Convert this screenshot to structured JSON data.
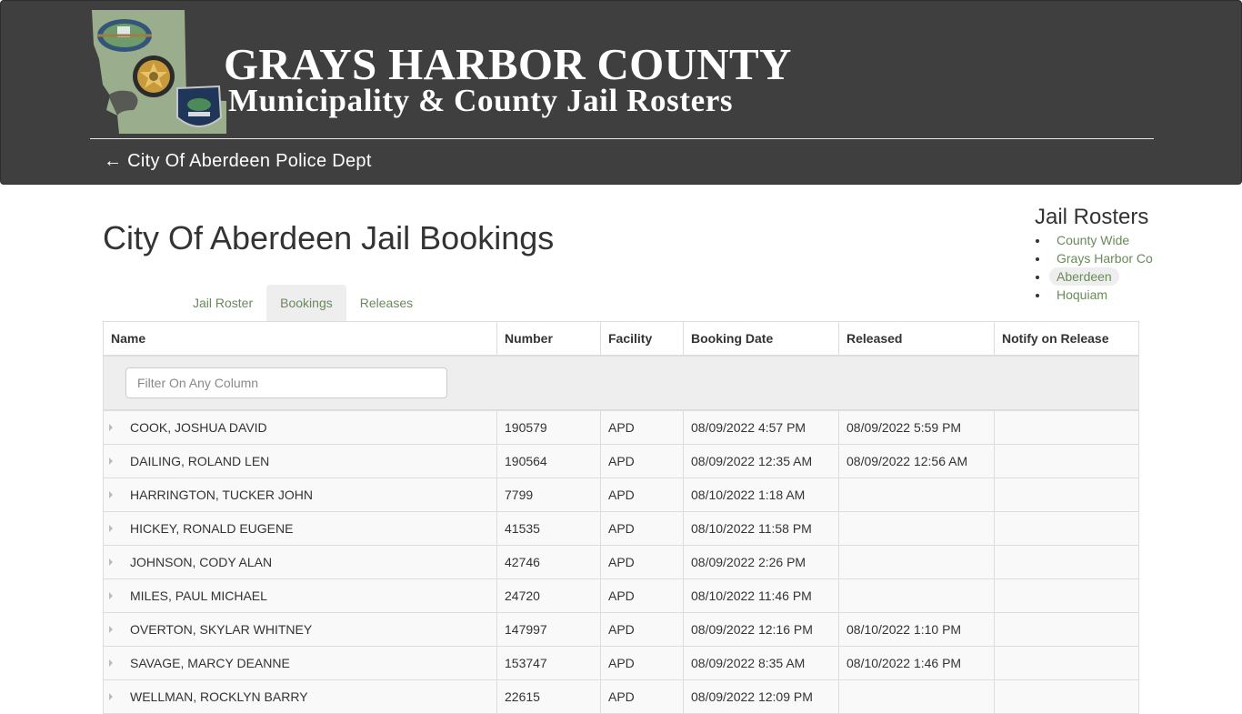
{
  "header": {
    "title": "GRAYS HARBOR COUNTY",
    "subtitle": "Municipality & County Jail Rosters",
    "back_link": "← City Of Aberdeen Police Dept",
    "colors": {
      "banner_bg": "#3f3f3f",
      "map_green": "#9aad8c"
    }
  },
  "page": {
    "title": "City Of Aberdeen Jail Bookings"
  },
  "tabs": [
    {
      "label": "Jail Roster",
      "active": false
    },
    {
      "label": "Bookings",
      "active": true
    },
    {
      "label": "Releases",
      "active": false
    }
  ],
  "sidebar": {
    "heading": "Jail Rosters",
    "items": [
      {
        "label": "County Wide",
        "active": false
      },
      {
        "label": "Grays Harbor Co",
        "active": false
      },
      {
        "label": "Aberdeen",
        "active": true
      },
      {
        "label": "Hoquiam",
        "active": false
      }
    ],
    "link_color": "#6a8a5a"
  },
  "table": {
    "columns": [
      "Name",
      "Number",
      "Facility",
      "Booking Date",
      "Released",
      "Notify on Release"
    ],
    "filter_placeholder": "Filter On Any Column",
    "filter_value": "",
    "rows": [
      {
        "name": "COOK, JOSHUA DAVID",
        "number": "190579",
        "facility": "APD",
        "booking_date": "08/09/2022 4:57 PM",
        "released": "08/09/2022 5:59 PM",
        "notify": ""
      },
      {
        "name": "DAILING, ROLAND LEN",
        "number": "190564",
        "facility": "APD",
        "booking_date": "08/09/2022 12:35 AM",
        "released": "08/09/2022 12:56 AM",
        "notify": ""
      },
      {
        "name": "HARRINGTON, TUCKER JOHN",
        "number": "7799",
        "facility": "APD",
        "booking_date": "08/10/2022 1:18 AM",
        "released": "",
        "notify": ""
      },
      {
        "name": "HICKEY, RONALD EUGENE",
        "number": "41535",
        "facility": "APD",
        "booking_date": "08/10/2022 11:58 PM",
        "released": "",
        "notify": ""
      },
      {
        "name": "JOHNSON, CODY ALAN",
        "number": "42746",
        "facility": "APD",
        "booking_date": "08/09/2022 2:26 PM",
        "released": "",
        "notify": ""
      },
      {
        "name": "MILES, PAUL MICHAEL",
        "number": "24720",
        "facility": "APD",
        "booking_date": "08/10/2022 11:46 PM",
        "released": "",
        "notify": ""
      },
      {
        "name": "OVERTON, SKYLAR WHITNEY",
        "number": "147997",
        "facility": "APD",
        "booking_date": "08/09/2022 12:16 PM",
        "released": "08/10/2022 1:10 PM",
        "notify": ""
      },
      {
        "name": "SAVAGE, MARCY DEANNE",
        "number": "153747",
        "facility": "APD",
        "booking_date": "08/09/2022 8:35 AM",
        "released": "08/10/2022 1:46 PM",
        "notify": ""
      },
      {
        "name": "WELLMAN, ROCKLYN BARRY",
        "number": "22615",
        "facility": "APD",
        "booking_date": "08/09/2022 12:09 PM",
        "released": "",
        "notify": ""
      }
    ]
  }
}
